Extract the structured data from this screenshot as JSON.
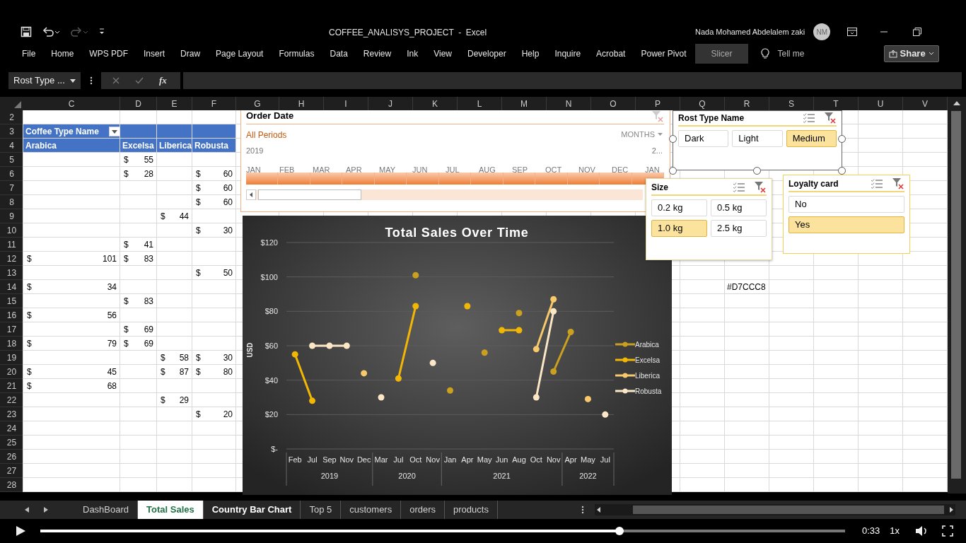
{
  "title_bar": {
    "title": "COFFEE_ANALISYS_PROJECT  -  Excel",
    "user_name": "Nada Mohamed Abdelalem zaki",
    "avatar_initials": "NM"
  },
  "ribbon_tabs": [
    {
      "label": "File",
      "selected": false
    },
    {
      "label": "Home",
      "selected": false
    },
    {
      "label": "WPS PDF",
      "selected": false
    },
    {
      "label": "Insert",
      "selected": false
    },
    {
      "label": "Draw",
      "selected": false
    },
    {
      "label": "Page Layout",
      "selected": false
    },
    {
      "label": "Formulas",
      "selected": false
    },
    {
      "label": "Data",
      "selected": false
    },
    {
      "label": "Review",
      "selected": false
    },
    {
      "label": "Ink",
      "selected": false
    },
    {
      "label": "View",
      "selected": false
    },
    {
      "label": "Developer",
      "selected": false
    },
    {
      "label": "Help",
      "selected": false
    },
    {
      "label": "Inquire",
      "selected": false
    },
    {
      "label": "Acrobat",
      "selected": false
    },
    {
      "label": "Power Pivot",
      "selected": false
    },
    {
      "label": "Slicer",
      "selected": true
    }
  ],
  "tell_me": "Tell me",
  "share_button": "Share",
  "formula_bar": {
    "name_box": "Rost Type ...",
    "function_label": "fx"
  },
  "sheet": {
    "columns": [
      "C",
      "D",
      "E",
      "F",
      "G",
      "H",
      "I",
      "J",
      "K",
      "L",
      "M",
      "N",
      "O",
      "P",
      "Q",
      "R",
      "S",
      "T",
      "U",
      "V"
    ],
    "rows": [
      "2",
      "3",
      "4",
      "5",
      "6",
      "7",
      "8",
      "9",
      "10",
      "11",
      "12",
      "13",
      "14",
      "15",
      "16",
      "17",
      "18",
      "19",
      "20",
      "21",
      "22",
      "23",
      "24",
      "25",
      "26",
      "27",
      "28"
    ],
    "pivot": {
      "filter_label": "Coffee Type Name",
      "headers": [
        "Arabica",
        "Excelsa",
        "Liberica",
        "Robusta"
      ],
      "rows": [
        [
          null,
          [
            "$",
            "55"
          ],
          null,
          null
        ],
        [
          null,
          [
            "$",
            "28"
          ],
          null,
          [
            "$",
            "60"
          ]
        ],
        [
          null,
          null,
          null,
          [
            "$",
            "60"
          ]
        ],
        [
          null,
          null,
          null,
          [
            "$",
            "60"
          ]
        ],
        [
          null,
          null,
          [
            "$",
            "44"
          ],
          null
        ],
        [
          null,
          null,
          null,
          [
            "$",
            "30"
          ]
        ],
        [
          null,
          [
            "$",
            "41"
          ],
          null,
          null
        ],
        [
          [
            "$",
            "101"
          ],
          [
            "$",
            "83"
          ],
          null,
          null
        ],
        [
          null,
          null,
          null,
          [
            "$",
            "50"
          ]
        ],
        [
          [
            "$",
            "34"
          ],
          null,
          null,
          null
        ],
        [
          null,
          [
            "$",
            "83"
          ],
          null,
          null
        ],
        [
          [
            "$",
            "56"
          ],
          null,
          null,
          null
        ],
        [
          null,
          [
            "$",
            "69"
          ],
          null,
          null
        ],
        [
          [
            "$",
            "79"
          ],
          [
            "$",
            "69"
          ],
          null,
          null
        ],
        [
          null,
          null,
          [
            "$",
            "58"
          ],
          [
            "$",
            "30"
          ]
        ],
        [
          [
            "$",
            "45"
          ],
          null,
          [
            "$",
            "87"
          ],
          [
            "$",
            "80"
          ]
        ],
        [
          [
            "$",
            "68"
          ],
          null,
          null,
          null
        ],
        [
          null,
          null,
          [
            "$",
            "29"
          ],
          null
        ],
        [
          null,
          null,
          null,
          [
            "$",
            "20"
          ]
        ]
      ]
    },
    "note_cell": "#D7CCC8"
  },
  "timeline": {
    "title": "Order Date",
    "period": "All Periods",
    "level_label": "MONTHS",
    "year_start": "2019",
    "year_end": "2...",
    "months": [
      "JAN",
      "FEB",
      "MAR",
      "APR",
      "MAY",
      "JUN",
      "JUL",
      "AUG",
      "SEP",
      "OCT",
      "NOV",
      "DEC",
      "JAN"
    ]
  },
  "slicers": [
    {
      "title": "Rost Type Name",
      "items": [
        {
          "label": "Dark",
          "selected": false
        },
        {
          "label": "Light",
          "selected": false
        },
        {
          "label": "Medium",
          "selected": true
        }
      ]
    },
    {
      "title": "Size",
      "items": [
        {
          "label": "0.2 kg",
          "selected": false
        },
        {
          "label": "0.5 kg",
          "selected": false
        },
        {
          "label": "1.0 kg",
          "selected": true
        },
        {
          "label": "2.5 kg",
          "selected": false
        }
      ]
    },
    {
      "title": "Loyalty card",
      "items": [
        {
          "label": "No",
          "selected": false
        },
        {
          "label": "Yes",
          "selected": true
        }
      ]
    }
  ],
  "chart": {
    "chart_data": {
      "type": "line",
      "title": "Total Sales Over Time",
      "ylabel": "USD",
      "categories": [
        "Feb",
        "Jul",
        "Sep",
        "Nov",
        "Dec",
        "Mar",
        "Jul",
        "Oct",
        "Nov",
        "Jan",
        "Apr",
        "May",
        "Jun",
        "Aug",
        "Oct",
        "Nov",
        "Apr",
        "May",
        "Jul"
      ],
      "ylim": [
        0,
        120
      ],
      "grid": true,
      "legend": "right",
      "yticks": [
        {
          "value": 0,
          "label": "$-"
        },
        {
          "value": 20,
          "label": "$20"
        },
        {
          "value": 40,
          "label": "$40"
        },
        {
          "value": 60,
          "label": "$60"
        },
        {
          "value": 80,
          "label": "$80"
        },
        {
          "value": 100,
          "label": "$100"
        },
        {
          "value": 120,
          "label": "$120"
        }
      ],
      "series": [
        {
          "name": "Arabica",
          "color": "#c9a020",
          "marker": "circle",
          "values": [
            null,
            null,
            null,
            null,
            null,
            null,
            null,
            101,
            null,
            34,
            null,
            56,
            null,
            79,
            null,
            45,
            68,
            null,
            null
          ]
        },
        {
          "name": "Excelsa",
          "color": "#f2b705",
          "marker": "circle",
          "values": [
            55,
            28,
            null,
            null,
            null,
            null,
            41,
            83,
            null,
            null,
            83,
            null,
            69,
            69,
            null,
            null,
            null,
            null,
            null
          ]
        },
        {
          "name": "Liberica",
          "color": "#f7c96b",
          "marker": "circle",
          "values": [
            null,
            null,
            null,
            null,
            44,
            null,
            null,
            null,
            null,
            null,
            null,
            null,
            null,
            null,
            58,
            87,
            null,
            29,
            null
          ]
        },
        {
          "name": "Robusta",
          "color": "#fbe6c6",
          "marker": "circle",
          "values": [
            null,
            60,
            60,
            60,
            null,
            30,
            null,
            null,
            50,
            null,
            null,
            null,
            null,
            null,
            30,
            80,
            null,
            null,
            20
          ]
        }
      ]
    },
    "year_labels": [
      "2019",
      "2020",
      "2021",
      "2022"
    ]
  },
  "sheet_tabs": [
    {
      "label": "DashBoard",
      "selected": false,
      "hovered": false
    },
    {
      "label": "Total Sales",
      "selected": true,
      "hovered": false
    },
    {
      "label": "Country Bar Chart",
      "selected": false,
      "hovered": true
    },
    {
      "label": "Top 5",
      "selected": false,
      "hovered": false
    },
    {
      "label": "customers",
      "selected": false,
      "hovered": false
    },
    {
      "label": "orders",
      "selected": false,
      "hovered": false
    },
    {
      "label": "products",
      "selected": false,
      "hovered": false
    }
  ],
  "video_player": {
    "level": 0.72,
    "time": "0:33",
    "speed": "1x"
  }
}
